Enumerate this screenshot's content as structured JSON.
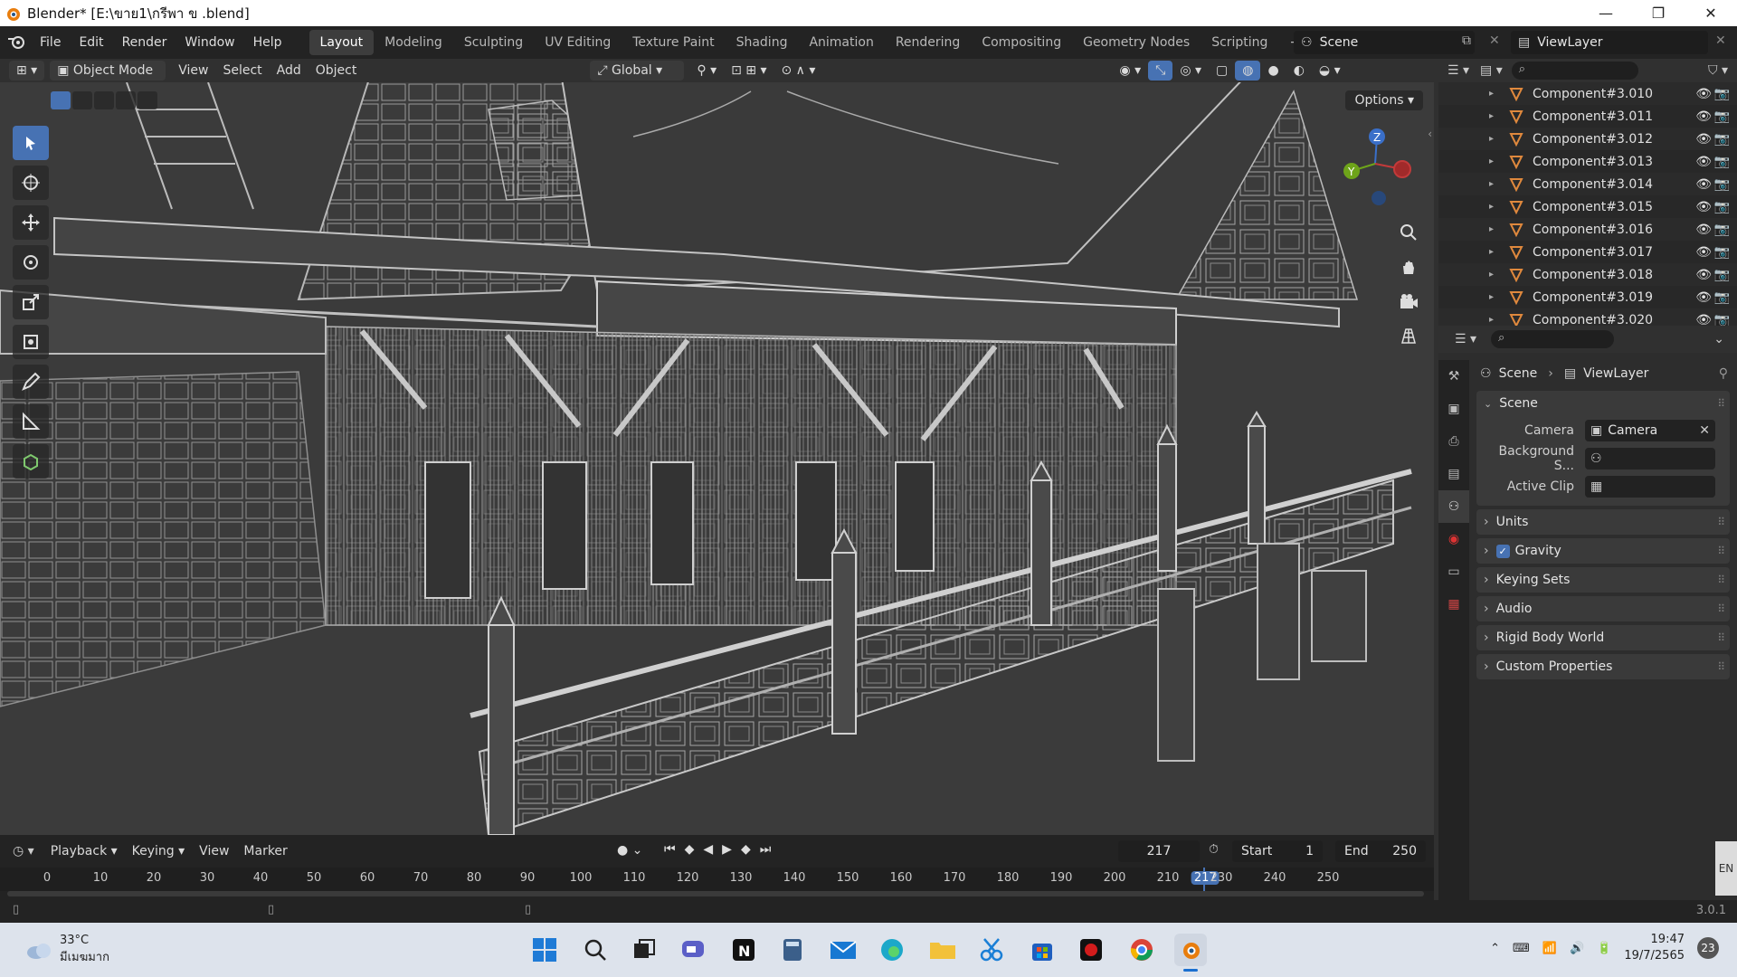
{
  "window": {
    "title": "Blender* [E:\\ขาย1\\กรีพา ข .blend]",
    "controls": [
      "—",
      "❐",
      "✕"
    ]
  },
  "menu": [
    "File",
    "Edit",
    "Render",
    "Window",
    "Help"
  ],
  "workspaces": [
    "Layout",
    "Modeling",
    "Sculpting",
    "UV Editing",
    "Texture Paint",
    "Shading",
    "Animation",
    "Rendering",
    "Compositing",
    "Geometry Nodes",
    "Scripting",
    "+"
  ],
  "active_workspace": "Layout",
  "scene_name": "Scene",
  "view_layer": "ViewLayer",
  "viewport_header": {
    "mode": "Object Mode",
    "menus": [
      "View",
      "Select",
      "Add",
      "Object"
    ],
    "transform_orientation": "Global",
    "options_label": "Options"
  },
  "outliner": {
    "items": [
      "Component#3.010",
      "Component#3.011",
      "Component#3.012",
      "Component#3.013",
      "Component#3.014",
      "Component#3.015",
      "Component#3.016",
      "Component#3.017",
      "Component#3.018",
      "Component#3.019",
      "Component#3.020"
    ]
  },
  "properties": {
    "breadcrumb_scene": "Scene",
    "breadcrumb_layer": "ViewLayer",
    "section": "Scene",
    "camera_label": "Camera",
    "camera_value": "Camera",
    "background_label": "Background S...",
    "active_clip_label": "Active Clip",
    "panels": [
      "Units",
      "Gravity",
      "Keying Sets",
      "Audio",
      "Rigid Body World",
      "Custom Properties"
    ],
    "gravity_checked": true
  },
  "timeline": {
    "menus": [
      "Playback",
      "Keying",
      "View",
      "Marker"
    ],
    "current_frame": "217",
    "start_label": "Start",
    "start_value": "1",
    "end_label": "End",
    "end_value": "250",
    "ticks": [
      "0",
      "10",
      "20",
      "30",
      "40",
      "50",
      "60",
      "70",
      "80",
      "90",
      "100",
      "110",
      "120",
      "130",
      "140",
      "150",
      "160",
      "170",
      "180",
      "190",
      "200",
      "210",
      "217",
      "230",
      "240",
      "250"
    ]
  },
  "status": {
    "version": "3.0.1",
    "lang": "EN"
  },
  "taskbar": {
    "temperature": "33°C",
    "weather_desc": "มีเมฆมาก",
    "time": "19:47",
    "date": "19/7/2565",
    "notifications": "23"
  },
  "colors": {
    "accent": "#4772b3",
    "axis_x": "#c23a3a",
    "axis_y": "#6ea41a",
    "axis_z": "#3a6fc9",
    "object_icon": "#e0893d"
  }
}
